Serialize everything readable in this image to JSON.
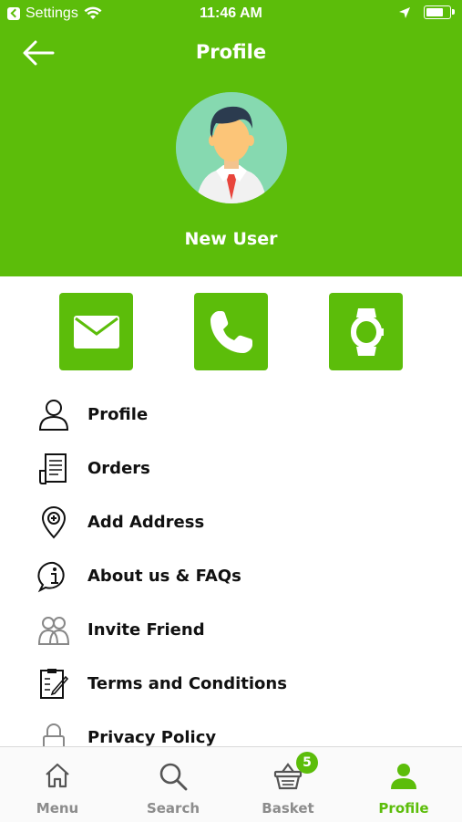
{
  "status_bar": {
    "back_app": "Settings",
    "time": "11:46 AM"
  },
  "header": {
    "title": "Profile",
    "user_name": "New User",
    "bg_color": "#5cbd0a"
  },
  "quick_actions": [
    {
      "name": "email",
      "icon": "envelope-icon"
    },
    {
      "name": "phone",
      "icon": "phone-icon"
    },
    {
      "name": "watch",
      "icon": "watch-icon"
    }
  ],
  "menu": {
    "items": [
      {
        "label": "Profile",
        "icon": "person-icon"
      },
      {
        "label": "Orders",
        "icon": "orders-icon"
      },
      {
        "label": "Add Address",
        "icon": "location-pin-icon"
      },
      {
        "label": "About us & FAQs",
        "icon": "info-icon"
      },
      {
        "label": "Invite Friend",
        "icon": "friends-icon"
      },
      {
        "label": "Terms and Conditions",
        "icon": "document-icon"
      },
      {
        "label": "Privacy Policy",
        "icon": "lock-icon"
      }
    ]
  },
  "tabs": [
    {
      "label": "Menu",
      "icon": "home-icon"
    },
    {
      "label": "Search",
      "icon": "search-icon"
    },
    {
      "label": "Basket",
      "icon": "basket-icon",
      "badge": "5"
    },
    {
      "label": "Profile",
      "icon": "profile-icon",
      "active": true
    }
  ]
}
